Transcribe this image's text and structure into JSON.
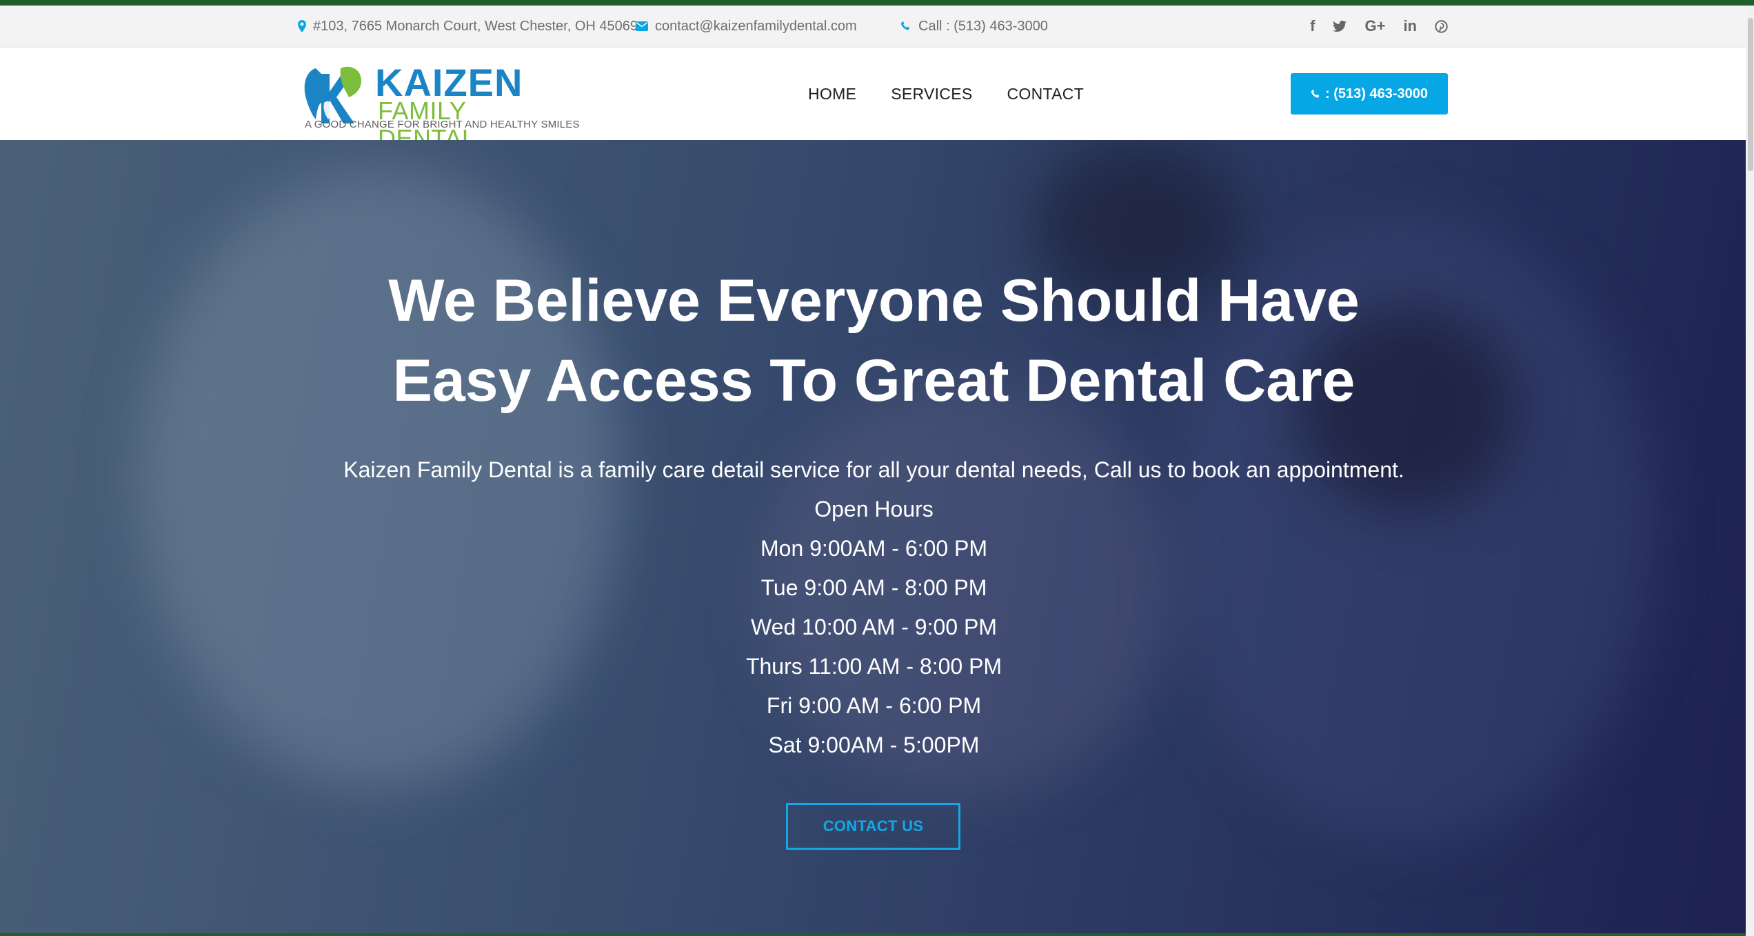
{
  "topbar": {
    "address": "#103, 7665 Monarch Court, West Chester, OH 45069",
    "email": "contact@kaizenfamilydental.com",
    "phone": "Call : (513) 463-3000",
    "social_icons": [
      "facebook-icon",
      "twitter-icon",
      "google-plus-icon",
      "linkedin-icon",
      "pinterest-icon"
    ],
    "social_glyphs": [
      "f",
      "t",
      "G+",
      "in",
      "p"
    ]
  },
  "logo": {
    "word": "KAIZEN",
    "sub": "FAMILY DENTAL",
    "tagline": "A GOOD CHANGE FOR BRIGHT AND HEALTHY SMILES"
  },
  "nav": {
    "home": "HOME",
    "services": "SERVICES",
    "contact": "CONTACT"
  },
  "header_cta": ": (513) 463-3000",
  "hero": {
    "title_line1": "We Believe Everyone Should Have",
    "title_line2": "Easy Access To Great Dental Care",
    "description": "Kaizen Family Dental is a family care detail service for all your dental needs, Call us to book an appointment.",
    "hours_heading": "Open Hours",
    "hours": [
      "Mon 9:00AM - 6:00 PM",
      "Tue 9:00 AM - 8:00 PM",
      "Wed 10:00 AM - 9:00 PM",
      "Thurs 11:00 AM - 8:00 PM",
      "Fri 9:00 AM - 6:00 PM",
      "Sat 9:00AM - 5:00PM"
    ],
    "cta": "CONTACT US"
  },
  "colors": {
    "accent_blue": "#07a7e6",
    "logo_blue": "#1b84c4",
    "logo_green": "#7cbd3b",
    "top_accent": "#1f5f2a",
    "hero_overlay": "#2c3a62"
  }
}
